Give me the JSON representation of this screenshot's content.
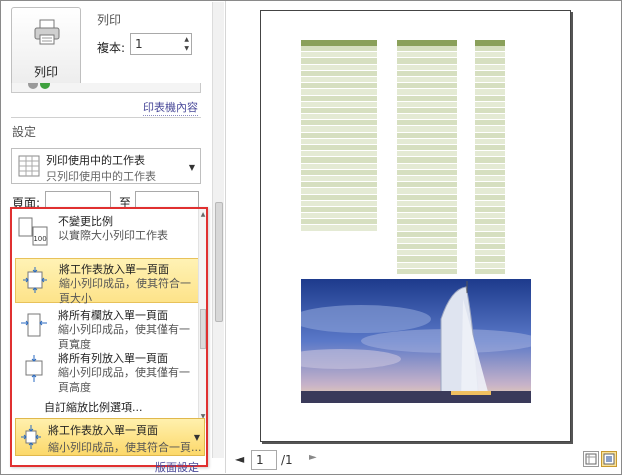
{
  "print": {
    "section_title": "列印",
    "button_label": "列印",
    "copies_label": "複本:",
    "copies_value": "1",
    "printer_properties_link": "印表機內容"
  },
  "settings": {
    "section_title": "設定",
    "what_to_print": {
      "title": "列印使用中的工作表",
      "subtitle": "只列印使用中的工作表"
    },
    "pages_label": "頁面:",
    "to_label": "至"
  },
  "scaling_menu": {
    "options": [
      {
        "title": "不變更比例",
        "desc": "以實際大小列印工作表",
        "icon": "actual-size-icon",
        "icon_text": "100",
        "selected": false
      },
      {
        "title": "將工作表放入單一頁面",
        "desc": "縮小列印成品，使其符合一頁大小",
        "icon": "fit-sheet-icon",
        "selected": true
      },
      {
        "title": "將所有欄放入單一頁面",
        "desc": "縮小列印成品，使其僅有一頁寬度",
        "icon": "fit-columns-icon",
        "selected": false
      },
      {
        "title": "將所有列放入單一頁面",
        "desc": "縮小列印成品，使其僅有一頁高度",
        "icon": "fit-rows-icon",
        "selected": false
      }
    ],
    "custom_scaling": "自訂縮放比例選項...",
    "current": {
      "title": "將工作表放入單一頁面",
      "desc": "縮小列印成品，使其符合一頁..."
    }
  },
  "page_setup_link": "版面設定",
  "preview": {
    "current_page": "1",
    "total_pages": "/1"
  },
  "colors": {
    "accent_border": "#e03030",
    "selected_bg": "#fde38a",
    "table_header": "#8aa05a"
  }
}
